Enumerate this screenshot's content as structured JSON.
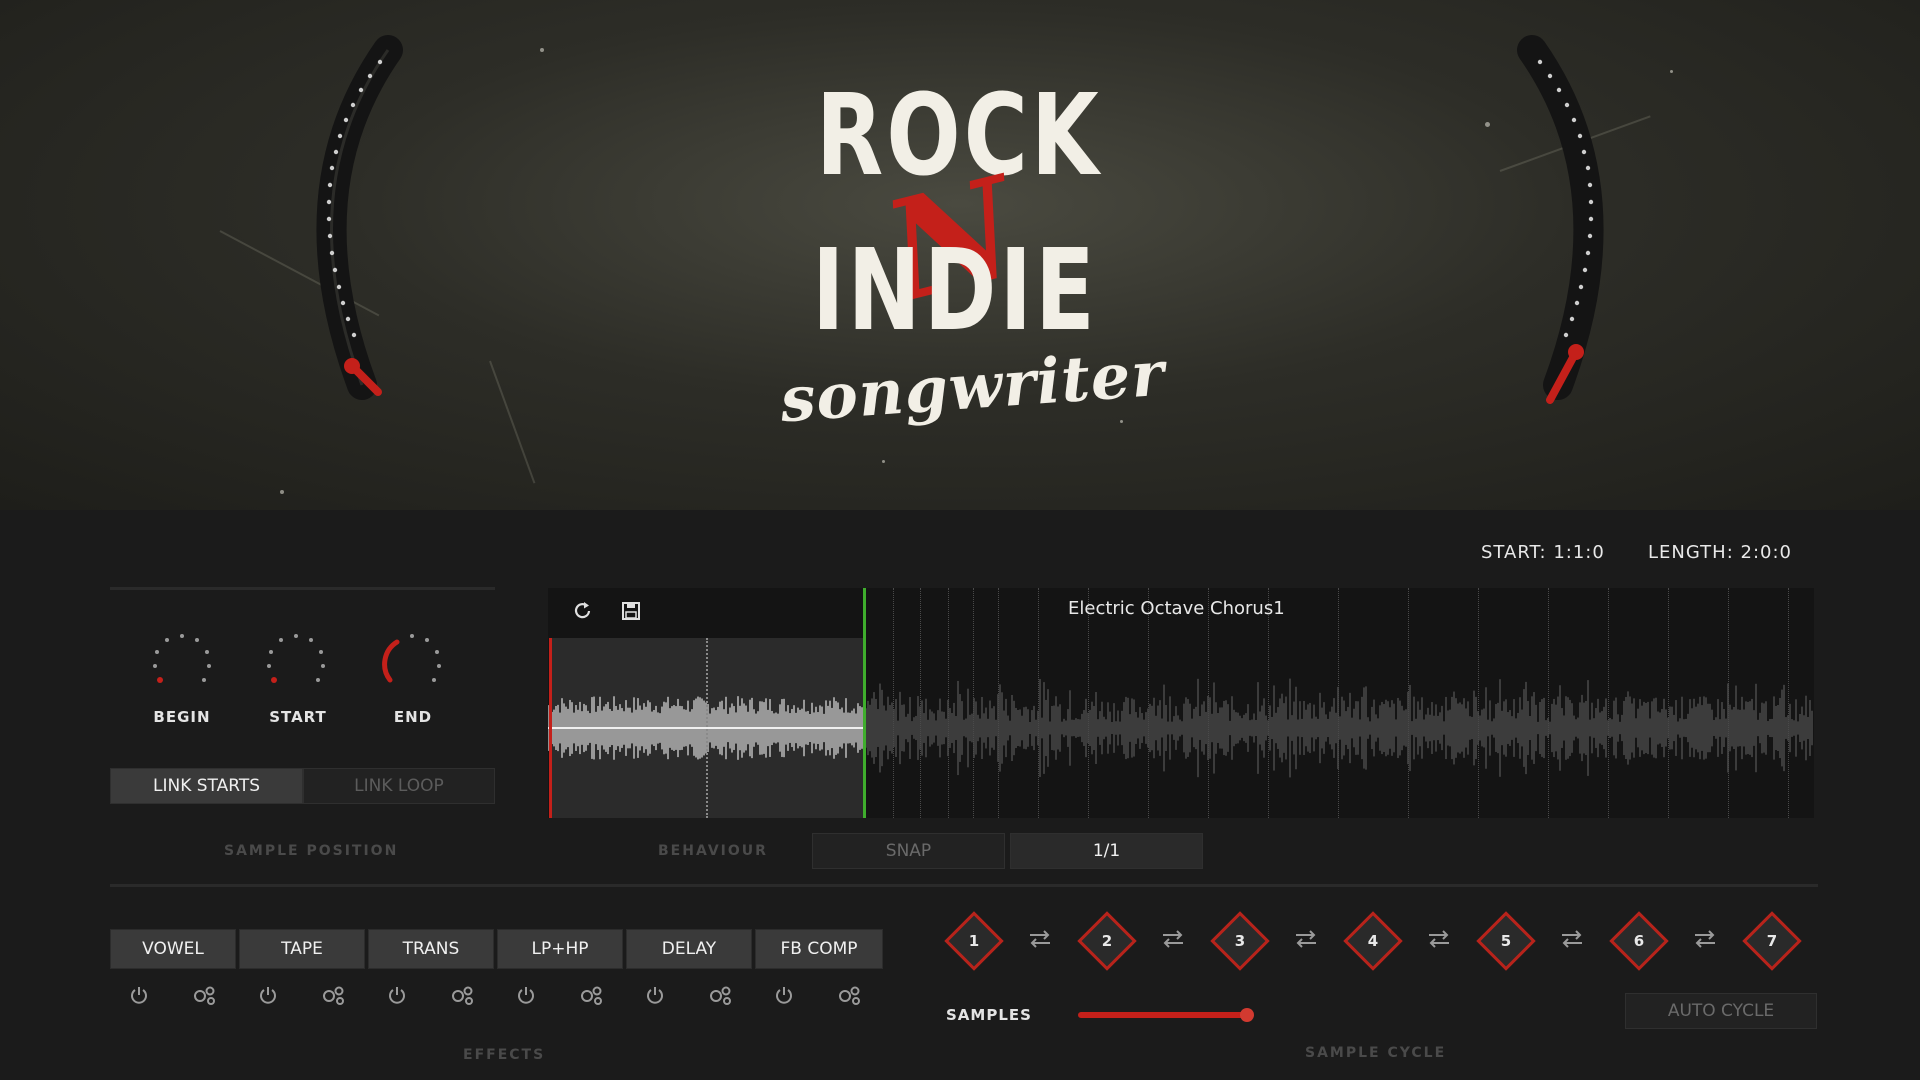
{
  "logo": {
    "rock": "ROCK",
    "n": "N",
    "indie": "INDIE",
    "songwriter": "songwriter"
  },
  "readout": {
    "start": "START: 1:1:0",
    "length": "LENGTH: 2:0:0"
  },
  "sample_position": {
    "knobs": [
      {
        "label": "BEGIN"
      },
      {
        "label": "START"
      },
      {
        "label": "END"
      }
    ],
    "link_starts": "LINK STARTS",
    "link_loop": "LINK LOOP",
    "section_label": "SAMPLE POSITION"
  },
  "waveform": {
    "sample_name": "Electric Octave Chorus1",
    "icons": [
      "refresh-icon",
      "save-icon"
    ]
  },
  "behaviour": {
    "label": "BEHAVIOUR",
    "snap": "SNAP",
    "division": "1/1"
  },
  "effects": {
    "section_label": "EFFECTS",
    "items": [
      {
        "label": "VOWEL"
      },
      {
        "label": "TAPE"
      },
      {
        "label": "TRANS"
      },
      {
        "label": "LP+HP"
      },
      {
        "label": "DELAY"
      },
      {
        "label": "FB COMP"
      }
    ]
  },
  "sample_cycle": {
    "section_label": "SAMPLE CYCLE",
    "slots": [
      "1",
      "2",
      "3",
      "4",
      "5",
      "6",
      "7"
    ],
    "samples_label": "SAMPLES",
    "auto_cycle": "AUTO CYCLE"
  },
  "colors": {
    "accent": "#c4201a",
    "marker_end": "#3fae2d",
    "button_on": "#3a3a3a"
  }
}
